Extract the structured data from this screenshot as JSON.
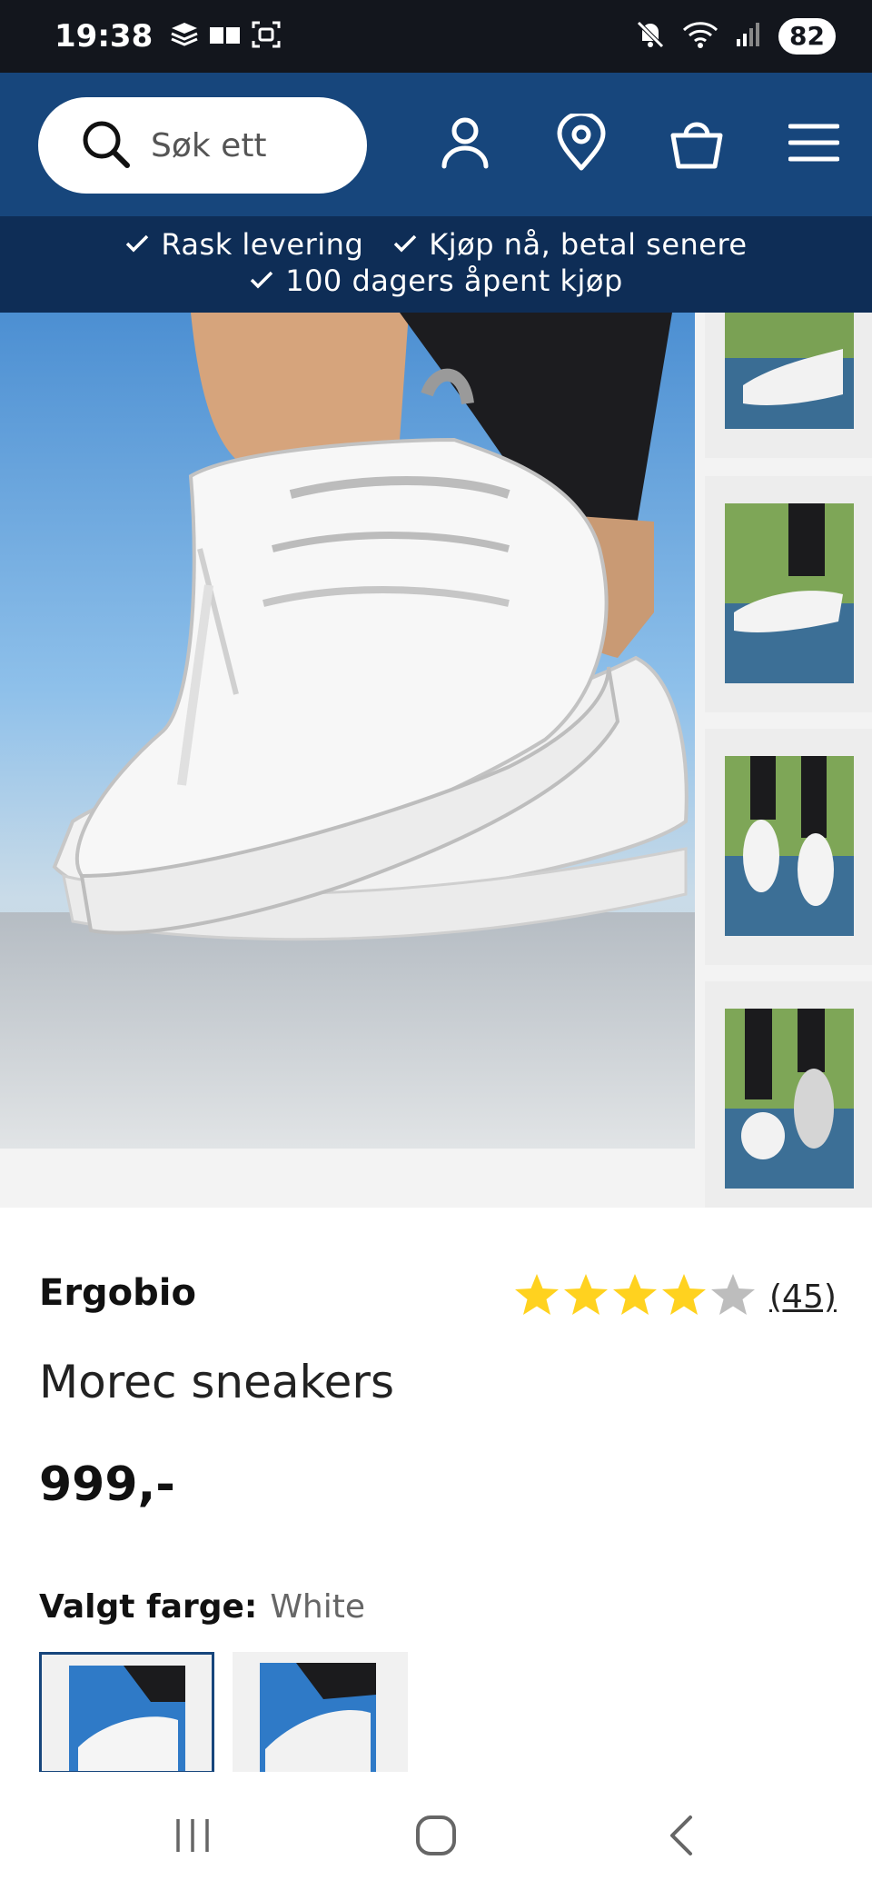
{
  "status_bar": {
    "time": "19:38",
    "battery": "82",
    "icons": [
      "stack-icon",
      "sim-cards-icon",
      "screenshot-icon",
      "mute-icon",
      "wifi-icon",
      "signal-icon"
    ]
  },
  "header": {
    "search_placeholder": "Søk ett",
    "icons": [
      "search-icon",
      "account-icon",
      "store-location-icon",
      "shopping-bag-icon",
      "menu-icon"
    ],
    "background": "#17467c"
  },
  "usp": {
    "items": [
      "Rask levering",
      "Kjøp nå, betal senere",
      "100 dagers åpent kjøp"
    ],
    "background": "#0e2d56"
  },
  "gallery": {
    "main_image": "white-sneakers-on-feet-photo",
    "thumbnails": [
      "thumbnail-1",
      "thumbnail-2",
      "thumbnail-3",
      "thumbnail-4"
    ]
  },
  "product": {
    "brand": "Ergobio",
    "rating": {
      "value": 4,
      "max": 5,
      "count": "(45)",
      "star_color": "#ffd21f",
      "empty_star_color": "#bdbdbd"
    },
    "name": "Morec sneakers",
    "price": "999,-",
    "color_label": "Valgt farge:",
    "color_value": "White",
    "swatches": [
      "White",
      "White"
    ]
  },
  "nav_bar": {
    "icons": [
      "recent-apps-icon",
      "home-icon",
      "back-icon"
    ]
  }
}
